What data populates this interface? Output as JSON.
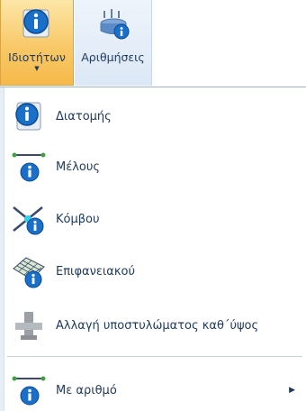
{
  "ribbon": {
    "properties_label": "Ιδιοτήτων",
    "calculations_label": "Αριθμήσεις"
  },
  "menu": {
    "items": [
      {
        "label": "Διατομής",
        "icon": "info-icon"
      },
      {
        "label": "Μέλους",
        "icon": "member-info-icon"
      },
      {
        "label": "Κόμβου",
        "icon": "node-info-icon"
      },
      {
        "label": "Επιφανειακού",
        "icon": "surface-info-icon"
      },
      {
        "label": "Αλλαγή υποστυλώματος καθ΄ύψος",
        "icon": "column-change-icon"
      },
      {
        "label": "Με αριθμό",
        "icon": "member-number-icon"
      }
    ]
  },
  "colors": {
    "text": "#1e395b",
    "info_blue": "#1a6fc9",
    "selected_bg": "#f8c968"
  }
}
